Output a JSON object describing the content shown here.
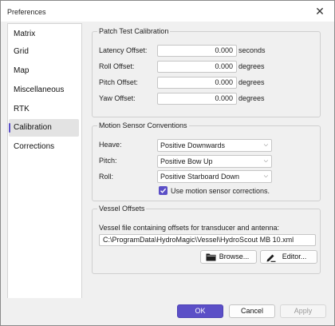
{
  "window": {
    "title": "Preferences",
    "close_glyph": "✕"
  },
  "nav": {
    "items": [
      {
        "label": "Matrix"
      },
      {
        "label": "Grid"
      },
      {
        "label": "Map"
      },
      {
        "label": "Miscellaneous"
      },
      {
        "label": "RTK"
      },
      {
        "label": "Calibration",
        "selected": true
      },
      {
        "label": "Corrections"
      }
    ]
  },
  "patch_test": {
    "legend": "Patch Test Calibration",
    "rows": [
      {
        "label": "Latency Offset:",
        "value": "0.000",
        "unit": "seconds"
      },
      {
        "label": "Roll Offset:",
        "value": "0.000",
        "unit": "degrees"
      },
      {
        "label": "Pitch Offset:",
        "value": "0.000",
        "unit": "degrees"
      },
      {
        "label": "Yaw Offset:",
        "value": "0.000",
        "unit": "degrees"
      }
    ]
  },
  "motion": {
    "legend": "Motion Sensor Conventions",
    "heave": {
      "label": "Heave:",
      "value": "Positive Downwards"
    },
    "pitch": {
      "label": "Pitch:",
      "value": "Positive Bow Up"
    },
    "roll": {
      "label": "Roll:",
      "value": "Positive Starboard Down"
    },
    "use_corrections": {
      "label": "Use motion sensor corrections.",
      "checked": true
    }
  },
  "vessel": {
    "legend": "Vessel Offsets",
    "description": "Vessel file containing offsets for transducer and antenna:",
    "path": "C:\\ProgramData\\HydroMagic\\Vessel\\HydroScout MB 10.xml",
    "browse_label": "Browse...",
    "editor_label": "Editor..."
  },
  "footer": {
    "ok_label": "OK",
    "cancel_label": "Cancel",
    "apply_label": "Apply"
  },
  "colors": {
    "accent": "#5b4fc7"
  }
}
